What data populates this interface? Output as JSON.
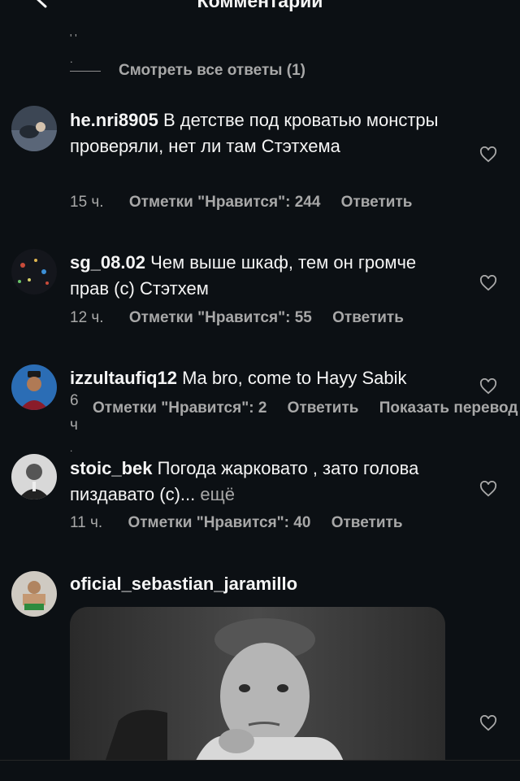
{
  "header": {
    "title": "Комментарии",
    "back_icon": "chevron-left-icon"
  },
  "thread_fragment": {
    "line1": "' '",
    "line2": "."
  },
  "view_replies": {
    "label": "Смотреть все ответы (1)"
  },
  "comments": [
    {
      "username": "he.nri8905",
      "text": "В детстве под кроватью монстры проверяли, нет ли там Стэтхема",
      "time": "15 ч.",
      "likes": "Отметки \"Нравится\": 244",
      "reply": "Ответить"
    },
    {
      "username": "sg_08.02",
      "text": "Чем выше шкаф, тем он громче прав (с) Стэтхем",
      "time": "12 ч.",
      "likes": "Отметки \"Нравится\": 55",
      "reply": "Ответить"
    },
    {
      "username": "izzultaufiq12",
      "text": "Ma bro, come to Hayy Sabik",
      "time": "6 ч",
      "time_tail": ".",
      "likes": "Отметки \"Нравится\": 2",
      "reply": "Ответить",
      "translate": "Показать перевод"
    },
    {
      "username": "stoic_bek",
      "text": "Погода жарковато , зато голова пиздавато (с)...",
      "more": "ещё",
      "time": "11 ч.",
      "likes": "Отметки \"Нравится\": 40",
      "reply": "Ответить"
    },
    {
      "username": "oficial_sebastian_jaramillo"
    }
  ],
  "colors": {
    "background": "#0c1014",
    "text": "#f5f5f5",
    "secondary": "#a8a8a8"
  }
}
